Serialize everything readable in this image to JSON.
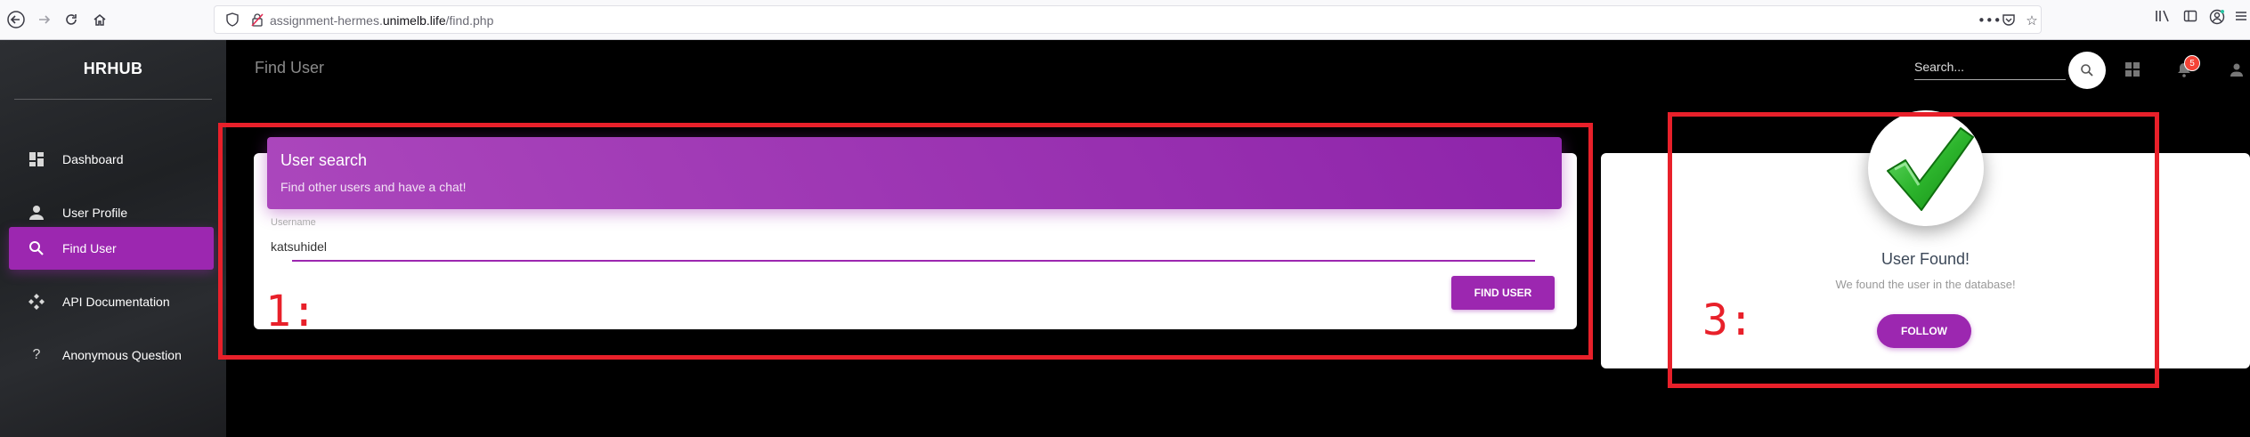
{
  "browser": {
    "url_prefix": "assignment-hermes.",
    "url_domain": "unimelb.life",
    "url_path": "/find.php"
  },
  "sidebar": {
    "brand": "HRHUB",
    "items": [
      {
        "label": "Dashboard",
        "icon": "dashboard-icon",
        "active": false
      },
      {
        "label": "User Profile",
        "icon": "person-icon",
        "active": false
      },
      {
        "label": "Find User",
        "icon": "search-icon",
        "active": true
      },
      {
        "label": "API Documentation",
        "icon": "api-icon",
        "active": false
      },
      {
        "label": "Anonymous Question",
        "icon": "question-icon",
        "active": false
      }
    ]
  },
  "navbar": {
    "page_title": "Find User",
    "search_placeholder": "Search...",
    "notification_count": "5"
  },
  "search_card": {
    "title": "User search",
    "subtitle": "Find other users and have a chat!",
    "field_label": "Username",
    "field_value": "katsuhidel",
    "button": "FIND USER"
  },
  "result_card": {
    "title": "User Found!",
    "subtitle": "We found the user in the database!",
    "button": "FOLLOW"
  },
  "annotations": {
    "label1": "1:",
    "label3": "3:"
  },
  "colors": {
    "accent": "#9c27b0",
    "annotation": "#e8202a",
    "check": "#2db52d"
  }
}
